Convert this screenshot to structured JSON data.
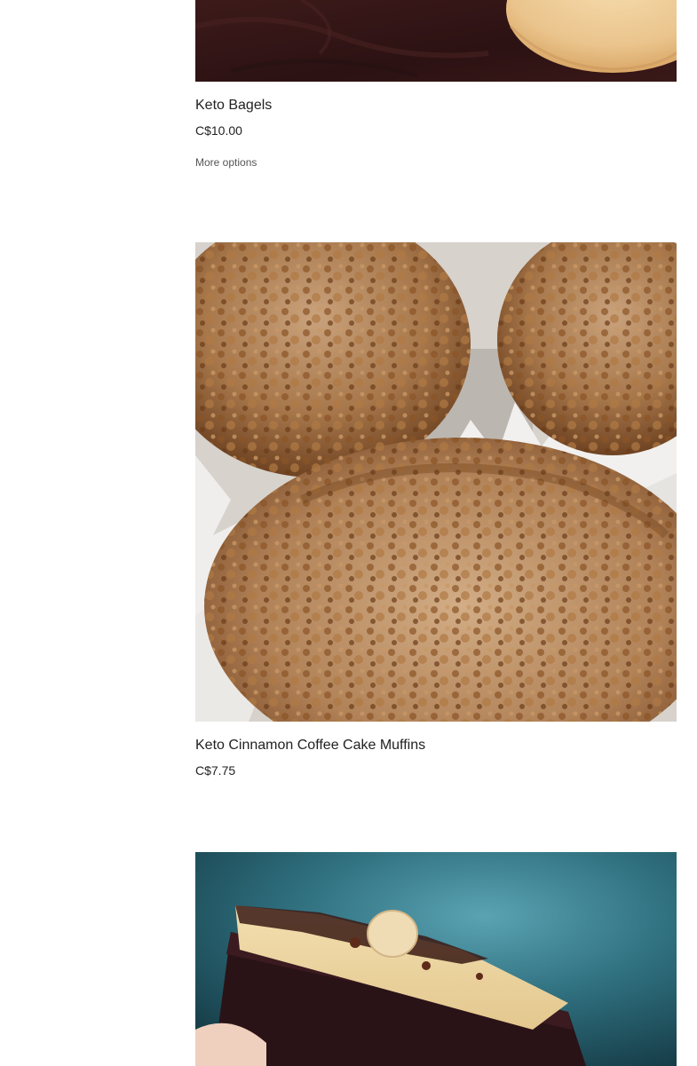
{
  "products": [
    {
      "title": "Keto Bagels",
      "price": "C$10.00",
      "more_options": "More options",
      "image_subject": "keto-bagel-photo"
    },
    {
      "title": "Keto Cinnamon Coffee Cake Muffins",
      "price": "C$7.75",
      "image_subject": "coffee-cake-muffins-photo"
    },
    {
      "image_subject": "chocolate-peanut-bar-photo"
    }
  ]
}
